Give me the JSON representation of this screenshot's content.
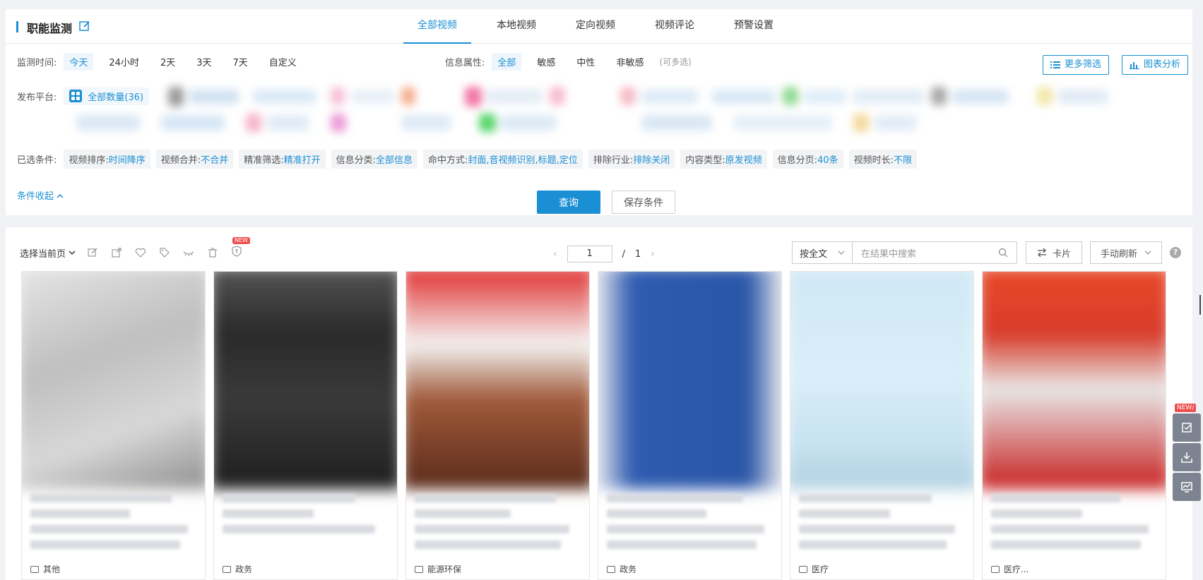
{
  "header": {
    "title": "职能监测",
    "tabs": [
      {
        "label": "全部视频",
        "active": true
      },
      {
        "label": "本地视频"
      },
      {
        "label": "定向视频"
      },
      {
        "label": "视频评论"
      },
      {
        "label": "预警设置"
      }
    ]
  },
  "filters": {
    "time_label": "监测时间:",
    "time_options": [
      "今天",
      "24小时",
      "2天",
      "3天",
      "7天",
      "自定义"
    ],
    "attr_label": "信息属性:",
    "attr_options": [
      "全部",
      "敏感",
      "中性",
      "非敏感"
    ],
    "attr_hint": "(可多选)",
    "more_filter": "更多筛选",
    "chart_analysis": "图表分析",
    "platform_label": "发布平台:",
    "platform_all": "全部数量(36)"
  },
  "conditions": {
    "label": "已选条件:",
    "chips": [
      {
        "k": "视频排序:",
        "v": "时间降序"
      },
      {
        "k": "视频合并:",
        "v": "不合并"
      },
      {
        "k": "精准筛选:",
        "v": "精准打开"
      },
      {
        "k": "信息分类:",
        "v": "全部信息"
      },
      {
        "k": "命中方式:",
        "v": "封面,音视频识别,标题,定位"
      },
      {
        "k": "排除行业:",
        "v": "排除关闭"
      },
      {
        "k": "内容类型:",
        "v": "原发视频"
      },
      {
        "k": "信息分页:",
        "v": "40条"
      },
      {
        "k": "视频时长:",
        "v": "不限"
      }
    ],
    "collapse": "条件收起",
    "query": "查询",
    "save": "保存条件"
  },
  "toolbar": {
    "select_page": "选择当前页",
    "new_badge": "NEW",
    "page_current": "1",
    "page_sep": "/",
    "page_total": "1",
    "search_type": "按全文",
    "search_placeholder": "在结果中搜索",
    "view_mode": "卡片",
    "refresh": "手动刷新"
  },
  "cards": [
    {
      "tag": "其他"
    },
    {
      "tag": "政务"
    },
    {
      "tag": "能源环保"
    },
    {
      "tag": "政务"
    },
    {
      "tag": "医疗"
    },
    {
      "tag": "医疗..."
    }
  ],
  "side": {
    "new_badge": "NEW/"
  }
}
